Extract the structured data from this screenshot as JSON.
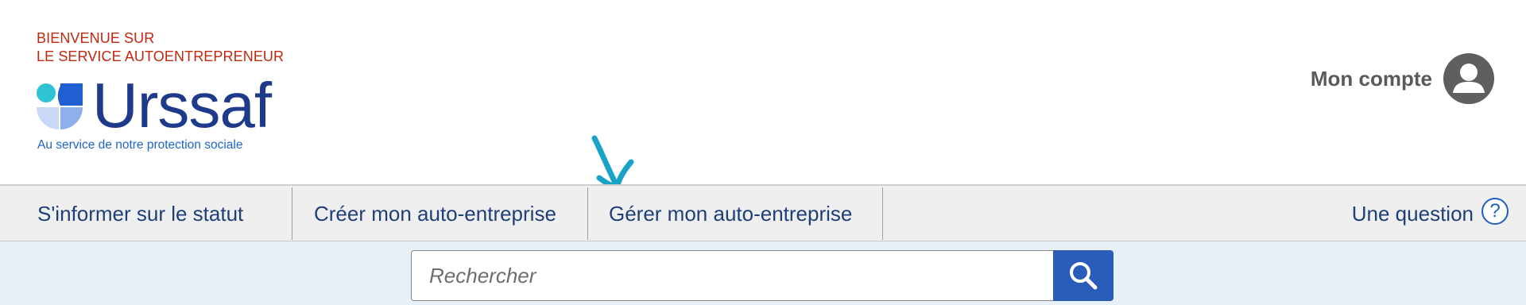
{
  "header": {
    "welcome_line1": "BIENVENUE SUR",
    "welcome_line2": "LE SERVICE AUTOENTREPRENEUR",
    "logo_word": "Urssaf",
    "logo_tagline": "Au service de notre protection sociale",
    "account_label": "Mon compte",
    "account_icon": "user-avatar-icon"
  },
  "nav": {
    "items": [
      {
        "label": "S'informer sur le statut"
      },
      {
        "label": "Créer mon auto-entreprise"
      },
      {
        "label": "Gérer mon auto-entreprise"
      }
    ],
    "question_label": "Une question",
    "question_icon": "question-circle-icon",
    "question_glyph": "?"
  },
  "annotation": {
    "arrow_icon": "hand-drawn-arrow-icon",
    "color": "#1aa3c8"
  },
  "search": {
    "placeholder": "Rechercher",
    "button_icon": "search-icon"
  },
  "colors": {
    "brand_red": "#c0290f",
    "brand_navy": "#1e3a8a",
    "nav_text": "#1e3f78",
    "search_button": "#2a5db9",
    "search_band": "#e8f0f7"
  }
}
